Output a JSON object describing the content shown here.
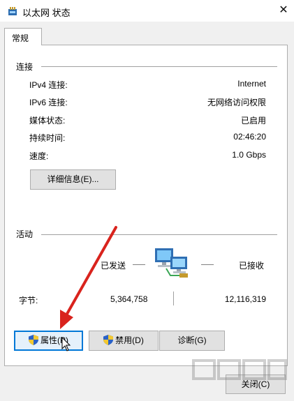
{
  "window": {
    "title": "以太网 状态",
    "close_glyph": "✕"
  },
  "tabs": [
    {
      "label": "常规"
    }
  ],
  "connection": {
    "group_label": "连接",
    "rows": [
      {
        "label": "IPv4 连接:",
        "value": "Internet"
      },
      {
        "label": "IPv6 连接:",
        "value": "无网络访问权限"
      },
      {
        "label": "媒体状态:",
        "value": "已启用"
      },
      {
        "label": "持续时间:",
        "value": "02:46:20"
      },
      {
        "label": "速度:",
        "value": "1.0 Gbps"
      }
    ],
    "details_button": "详细信息(E)..."
  },
  "activity": {
    "group_label": "活动",
    "sent_label": "已发送",
    "received_label": "已接收",
    "bytes_label": "字节:",
    "bytes_sent": "5,364,758",
    "bytes_received": "12,116,319"
  },
  "buttons": {
    "properties": "属性(P)",
    "disable": "禁用(D)",
    "diagnose": "诊断(G)",
    "close": "关闭(C)"
  },
  "icons": {
    "app": "network-adapter-icon",
    "activity": "network-computers-icon",
    "shield": "uac-shield-icon",
    "annotation": "red-arrow",
    "cursor": "mouse-pointer-icon"
  },
  "colors": {
    "focus_accent": "#0078d7",
    "annotation_arrow": "#d9231d"
  }
}
